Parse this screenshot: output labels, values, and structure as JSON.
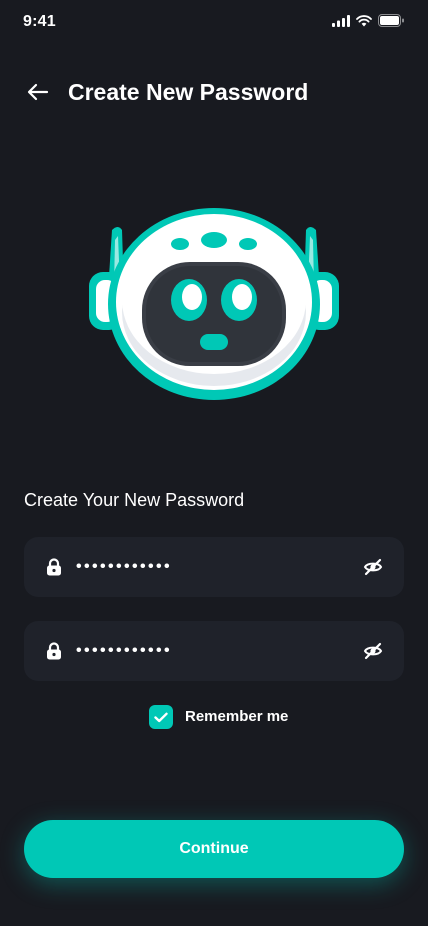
{
  "status_bar": {
    "time": "9:41"
  },
  "header": {
    "back_icon": "arrow-left-icon",
    "title": "Create New Password"
  },
  "illustration": {
    "name": "robot-mascot"
  },
  "form": {
    "section_title": "Create Your New Password",
    "fields": [
      {
        "icon": "lock-icon",
        "value": "••••••••••••",
        "toggle_icon": "eye-off-icon"
      },
      {
        "icon": "lock-icon",
        "value": "••••••••••••",
        "toggle_icon": "eye-off-icon"
      }
    ],
    "remember_me": {
      "label": "Remember me",
      "checked": true
    }
  },
  "actions": {
    "continue_label": "Continue"
  },
  "colors": {
    "background": "#181A20",
    "field_bg": "#1F222A",
    "accent": "#00C8B6",
    "text": "#FFFFFF"
  }
}
